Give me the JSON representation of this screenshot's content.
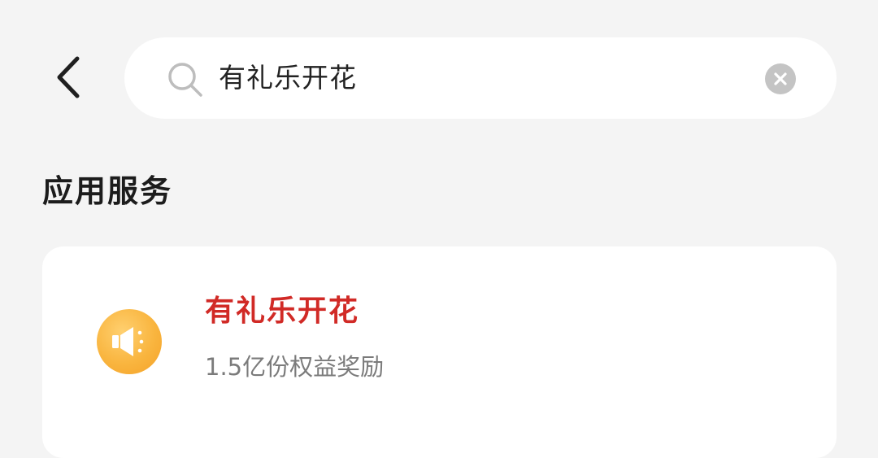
{
  "header": {
    "back_icon": "chevron-left-icon",
    "search": {
      "icon": "search-icon",
      "value": "有礼乐开花",
      "clear_icon": "clear-icon"
    }
  },
  "section": {
    "title": "应用服务"
  },
  "results": [
    {
      "name": "有礼乐开花",
      "description": "1.5亿份权益奖励",
      "icon": "megaphone-icon"
    }
  ],
  "colors": {
    "background": "#f4f4f4",
    "card": "#ffffff",
    "highlight_red": "#d12a26",
    "icon_orange": "#f9b53f",
    "secondary_text": "#7b7b7b"
  }
}
